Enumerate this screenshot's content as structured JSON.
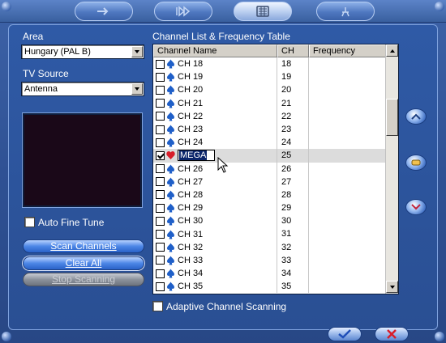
{
  "colors": {
    "frame_blue": "#2f5aa6",
    "pill_blue": "#4c86e6",
    "selection": "#0a246a",
    "spade_icon": "#1f5fc8",
    "heart_icon": "#d81e2a"
  },
  "toolbar": {
    "tabs": [
      {
        "icon": "arrow-icon",
        "active": false
      },
      {
        "icon": "play-forward-icon",
        "active": false
      },
      {
        "icon": "tv-settings-icon",
        "active": true
      },
      {
        "icon": "tools-icon",
        "active": false
      }
    ]
  },
  "area": {
    "label": "Area",
    "value": "Hungary (PAL B)"
  },
  "tv_source": {
    "label": "TV Source",
    "value": "Antenna"
  },
  "auto_fine_tune": {
    "label": "Auto Fine Tune",
    "checked": false
  },
  "buttons": {
    "scan_channels": "Scan Channels",
    "clear_all": "Clear All",
    "stop_scanning": "Stop Scanning"
  },
  "channel_table": {
    "title": "Channel List & Frequency Table",
    "columns": [
      "Channel Name",
      "CH",
      "Frequency"
    ],
    "rows": [
      {
        "name": "CH 18",
        "ch": "18",
        "frequency": "",
        "checked": false,
        "icon": "spade-icon"
      },
      {
        "name": "CH 19",
        "ch": "19",
        "frequency": "",
        "checked": false,
        "icon": "spade-icon"
      },
      {
        "name": "CH 20",
        "ch": "20",
        "frequency": "",
        "checked": false,
        "icon": "spade-icon"
      },
      {
        "name": "CH 21",
        "ch": "21",
        "frequency": "",
        "checked": false,
        "icon": "spade-icon"
      },
      {
        "name": "CH 22",
        "ch": "22",
        "frequency": "",
        "checked": false,
        "icon": "spade-icon"
      },
      {
        "name": "CH 23",
        "ch": "23",
        "frequency": "",
        "checked": false,
        "icon": "spade-icon"
      },
      {
        "name": "CH 24",
        "ch": "24",
        "frequency": "",
        "checked": false,
        "icon": "spade-icon"
      },
      {
        "name": "MEGA",
        "ch": "25",
        "frequency": "",
        "checked": true,
        "icon": "heart-icon",
        "editing": true
      },
      {
        "name": "CH 26",
        "ch": "26",
        "frequency": "",
        "checked": false,
        "icon": "spade-icon"
      },
      {
        "name": "CH 27",
        "ch": "27",
        "frequency": "",
        "checked": false,
        "icon": "spade-icon"
      },
      {
        "name": "CH 28",
        "ch": "28",
        "frequency": "",
        "checked": false,
        "icon": "spade-icon"
      },
      {
        "name": "CH 29",
        "ch": "29",
        "frequency": "",
        "checked": false,
        "icon": "spade-icon"
      },
      {
        "name": "CH 30",
        "ch": "30",
        "frequency": "",
        "checked": false,
        "icon": "spade-icon"
      },
      {
        "name": "CH 31",
        "ch": "31",
        "frequency": "",
        "checked": false,
        "icon": "spade-icon"
      },
      {
        "name": "CH 32",
        "ch": "32",
        "frequency": "",
        "checked": false,
        "icon": "spade-icon"
      },
      {
        "name": "CH 33",
        "ch": "33",
        "frequency": "",
        "checked": false,
        "icon": "spade-icon"
      },
      {
        "name": "CH 34",
        "ch": "34",
        "frequency": "",
        "checked": false,
        "icon": "spade-icon"
      },
      {
        "name": "CH 35",
        "ch": "35",
        "frequency": "",
        "checked": false,
        "icon": "spade-icon"
      }
    ]
  },
  "adaptive_scanning": {
    "label": "Adaptive Channel Scanning",
    "checked": false
  },
  "side_buttons": [
    "move-up-icon",
    "edit-icon",
    "move-down-icon"
  ],
  "dialog_actions": [
    "ok-check-icon",
    "cancel-x-icon"
  ]
}
